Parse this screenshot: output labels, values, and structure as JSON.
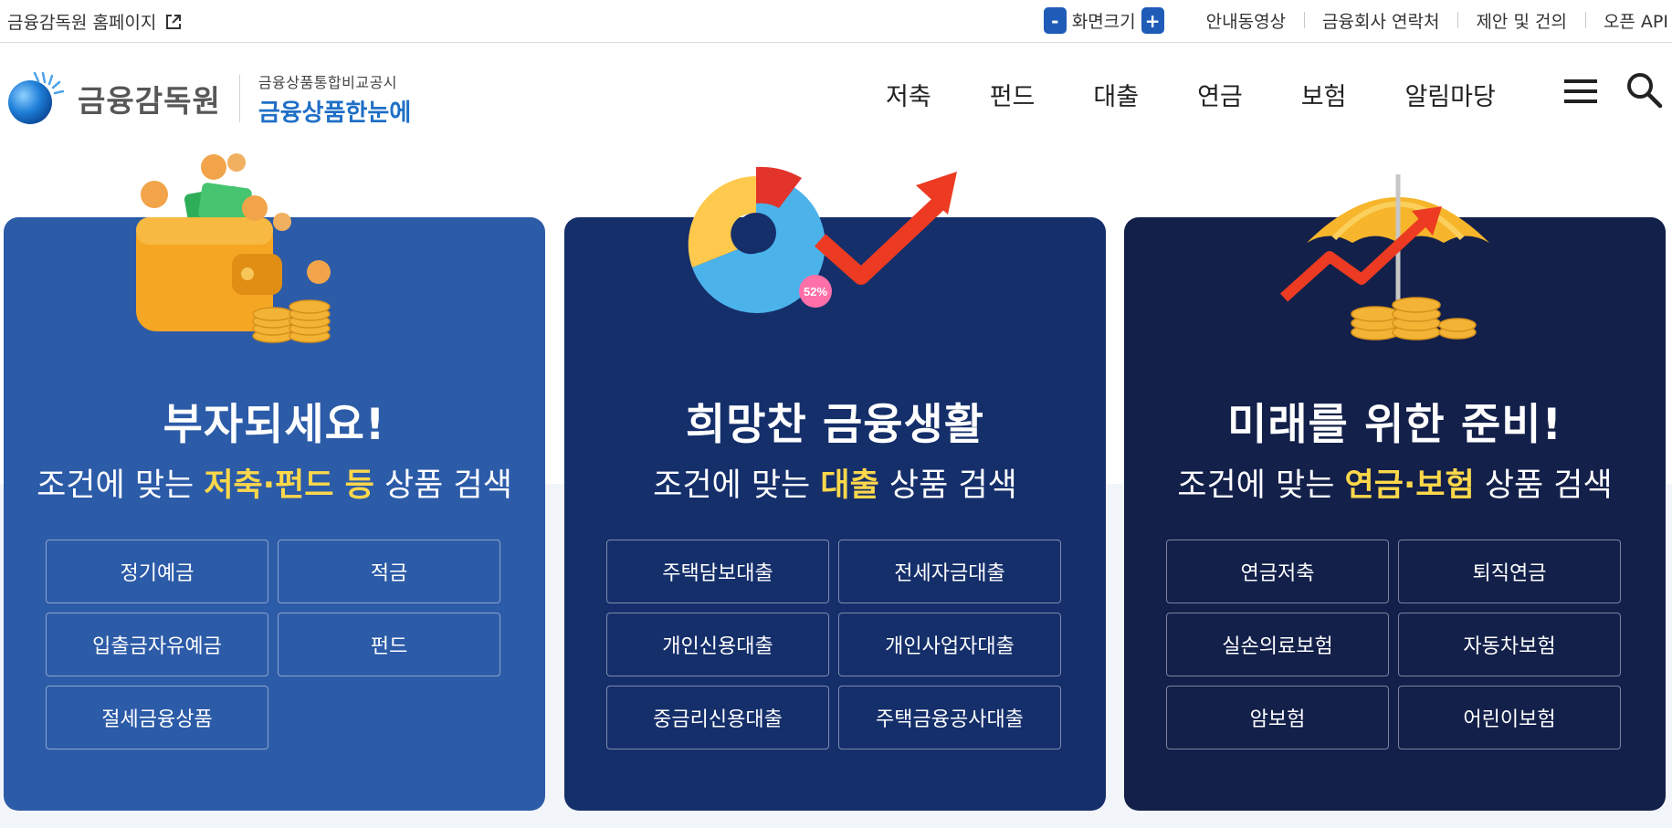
{
  "topbar": {
    "home_link": "금융감독원 홈페이지",
    "zoom_minus": "-",
    "zoom_label": "화면크기",
    "zoom_plus": "+",
    "links": [
      "안내동영상",
      "금융회사 연락처",
      "제안 및 건의",
      "오픈 API"
    ]
  },
  "header": {
    "brand": "금융감독원",
    "subtitle": "금융상품통합비교공시",
    "service_name": "금융상품한눈에",
    "nav": [
      "저축",
      "펀드",
      "대출",
      "연금",
      "보험",
      "알림마당"
    ]
  },
  "panels": [
    {
      "title": "부자되세요!",
      "sub_before": "조건에 맞는 ",
      "sub_highlight": "저축·펀드 등",
      "sub_after": " 상품 검색",
      "buttons": [
        "정기예금",
        "적금",
        "입출금자유예금",
        "펀드",
        "절세금융상품"
      ]
    },
    {
      "title": "희망찬 금융생활",
      "sub_before": "조건에 맞는 ",
      "sub_highlight": "대출",
      "sub_after": " 상품 검색",
      "badge": "52%",
      "buttons": [
        "주택담보대출",
        "전세자금대출",
        "개인신용대출",
        "개인사업자대출",
        "중금리신용대출",
        "주택금융공사대출"
      ]
    },
    {
      "title": "미래를 위한 준비!",
      "sub_before": "조건에 맞는 ",
      "sub_highlight": "연금·보험",
      "sub_after": " 상품 검색",
      "buttons": [
        "연금저축",
        "퇴직연금",
        "실손의료보험",
        "자동차보험",
        "암보험",
        "어린이보험"
      ]
    }
  ],
  "colors": {
    "accent_blue": "#1e5cb8",
    "brand_blue": "#1f6fc6",
    "panel1": "#2c5ba8",
    "panel2": "#152f6b",
    "panel3": "#13204a",
    "highlight": "#ffd84a"
  },
  "icons": [
    "external-link-icon",
    "menu-icon",
    "search-icon"
  ]
}
